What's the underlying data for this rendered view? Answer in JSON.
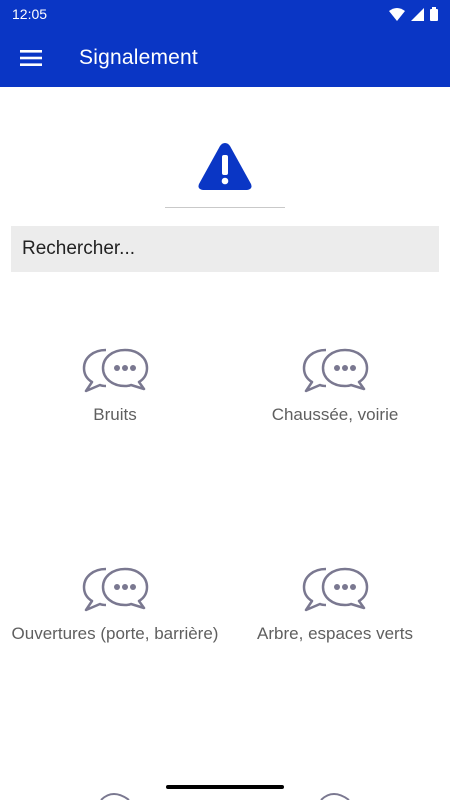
{
  "status_bar": {
    "time": "12:05"
  },
  "toolbar": {
    "title": "Signalement"
  },
  "search": {
    "placeholder": "Rechercher..."
  },
  "categories": [
    {
      "label": "Bruits",
      "icon": "chat-bubbles-icon"
    },
    {
      "label": "Chaussée, voirie",
      "icon": "chat-bubbles-icon"
    },
    {
      "label": "Ouvertures (porte, barrière)",
      "icon": "chat-bubbles-icon"
    },
    {
      "label": "Arbre, espaces verts",
      "icon": "chat-bubbles-icon"
    }
  ],
  "colors": {
    "primary": "#0A36C5",
    "icon": "#7A7890",
    "text": "#5f5f5f",
    "search_bg": "#ECECEC"
  }
}
